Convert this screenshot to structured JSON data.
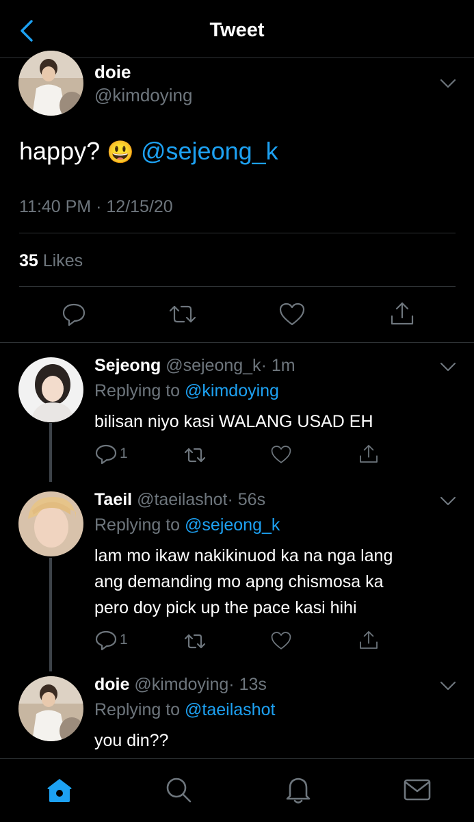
{
  "header": {
    "title": "Tweet",
    "back_icon": "chevron-left-icon"
  },
  "main_tweet": {
    "name": "doie",
    "handle": "@kimdoying",
    "text": "happy?",
    "emoji": "😃",
    "mention": "@sejeong_k",
    "time": "11:40 PM",
    "date_sep": "·",
    "date": "12/15/20",
    "likes_count": "35",
    "likes_label": "Likes"
  },
  "replies": [
    {
      "name": "Sejeong",
      "handle": "@sejeong_k",
      "time": "· 1m",
      "replying_label": "Replying to",
      "replying_to": "@kimdoying",
      "text": "bilisan niyo kasi WALANG USAD EH",
      "reply_count": "1"
    },
    {
      "name": "Taeil",
      "handle": "@taeilashot",
      "time": "· 56s",
      "replying_label": "Replying to",
      "replying_to": "@sejeong_k",
      "text_lines": [
        "lam mo ikaw nakikinuod ka na nga lang",
        "ang demanding mo apng chismosa ka",
        "pero doy pick up the pace kasi hihi"
      ],
      "reply_count": "1"
    },
    {
      "name": "doie",
      "handle": "@kimdoying",
      "time": "· 13s",
      "replying_label": "Replying to",
      "replying_to": "@taeilashot",
      "text": "you din??"
    }
  ],
  "tabbar": [
    "home-icon",
    "search-icon",
    "notifications-icon",
    "messages-icon"
  ],
  "colors": {
    "accent": "#1da1f2",
    "muted": "#6e767d",
    "background": "#000000",
    "separator": "#2f3336"
  }
}
